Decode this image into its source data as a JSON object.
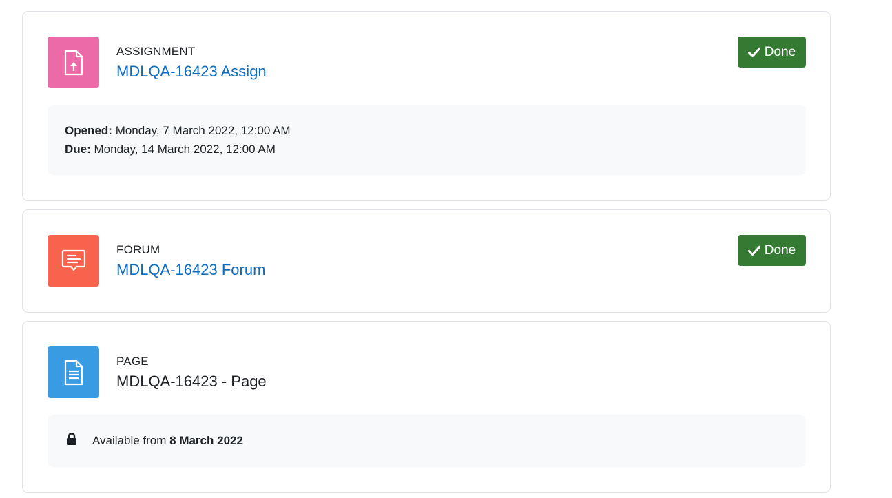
{
  "activities": [
    {
      "type": "ASSIGNMENT",
      "name": "MDLQA-16423 Assign",
      "icon": "assignment-upload-icon",
      "icon_color": "#ec6aa7",
      "completion": "Done",
      "dates": [
        {
          "label": "Opened:",
          "value": "Monday, 7 March 2022, 12:00 AM"
        },
        {
          "label": "Due:",
          "value": "Monday, 14 March 2022, 12:00 AM"
        }
      ]
    },
    {
      "type": "FORUM",
      "name": "MDLQA-16423 Forum",
      "icon": "forum-chat-icon",
      "icon_color": "#f7634d",
      "completion": "Done"
    },
    {
      "type": "PAGE",
      "name": "MDLQA-16423 - Page",
      "icon": "page-document-icon",
      "icon_color": "#399be2",
      "restriction": {
        "icon": "lock-icon",
        "prefix": "Available from",
        "date": "8 March 2022"
      }
    }
  ],
  "colors": {
    "done_green": "#357a32",
    "link_blue": "#0f6cbf",
    "info_bg": "#f8f9fa"
  }
}
